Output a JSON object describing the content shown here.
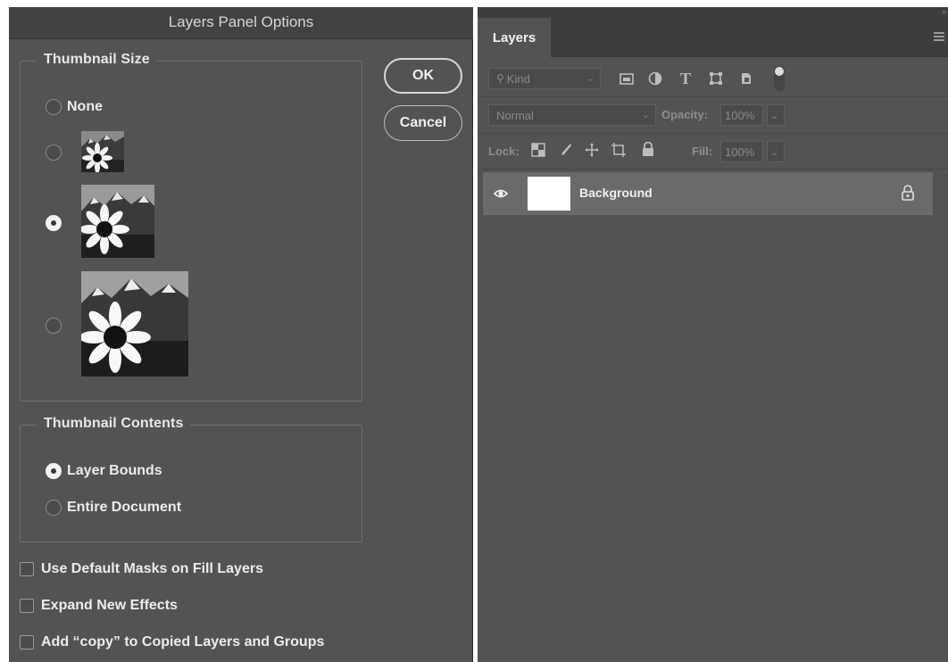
{
  "dialog": {
    "title": "Layers Panel Options",
    "thumbnail_size": {
      "legend": "Thumbnail Size",
      "none_label": "None",
      "selected": "medium"
    },
    "thumbnail_contents": {
      "legend": "Thumbnail Contents",
      "option_layer_bounds": "Layer Bounds",
      "option_entire_document": "Entire Document",
      "selected": "Layer Bounds"
    },
    "checkboxes": {
      "default_masks": "Use Default Masks on Fill Layers",
      "expand_effects": "Expand New Effects",
      "add_copy": "Add “copy” to Copied Layers and Groups"
    },
    "buttons": {
      "ok": "OK",
      "cancel": "Cancel"
    }
  },
  "layers_panel": {
    "tab": "Layers",
    "filter_placeholder": "Kind",
    "blend_mode": "Normal",
    "opacity_label": "Opacity:",
    "opacity_value": "100%",
    "lock_label": "Lock:",
    "fill_label": "Fill:",
    "fill_value": "100%",
    "layers": [
      {
        "name": "Background",
        "visible": true,
        "locked": true
      }
    ]
  },
  "icons": {
    "filter_pixel": "image-icon",
    "filter_adjustment": "half-circle-icon",
    "filter_type": "T",
    "filter_shape": "shape-icon",
    "filter_smart": "smart-object-icon",
    "filter_toggle": "toggle-dot-icon"
  },
  "colors": {
    "dialog_bg": "#535353",
    "panel_bg": "#535353",
    "selected_layer": "#6a6a6a"
  }
}
